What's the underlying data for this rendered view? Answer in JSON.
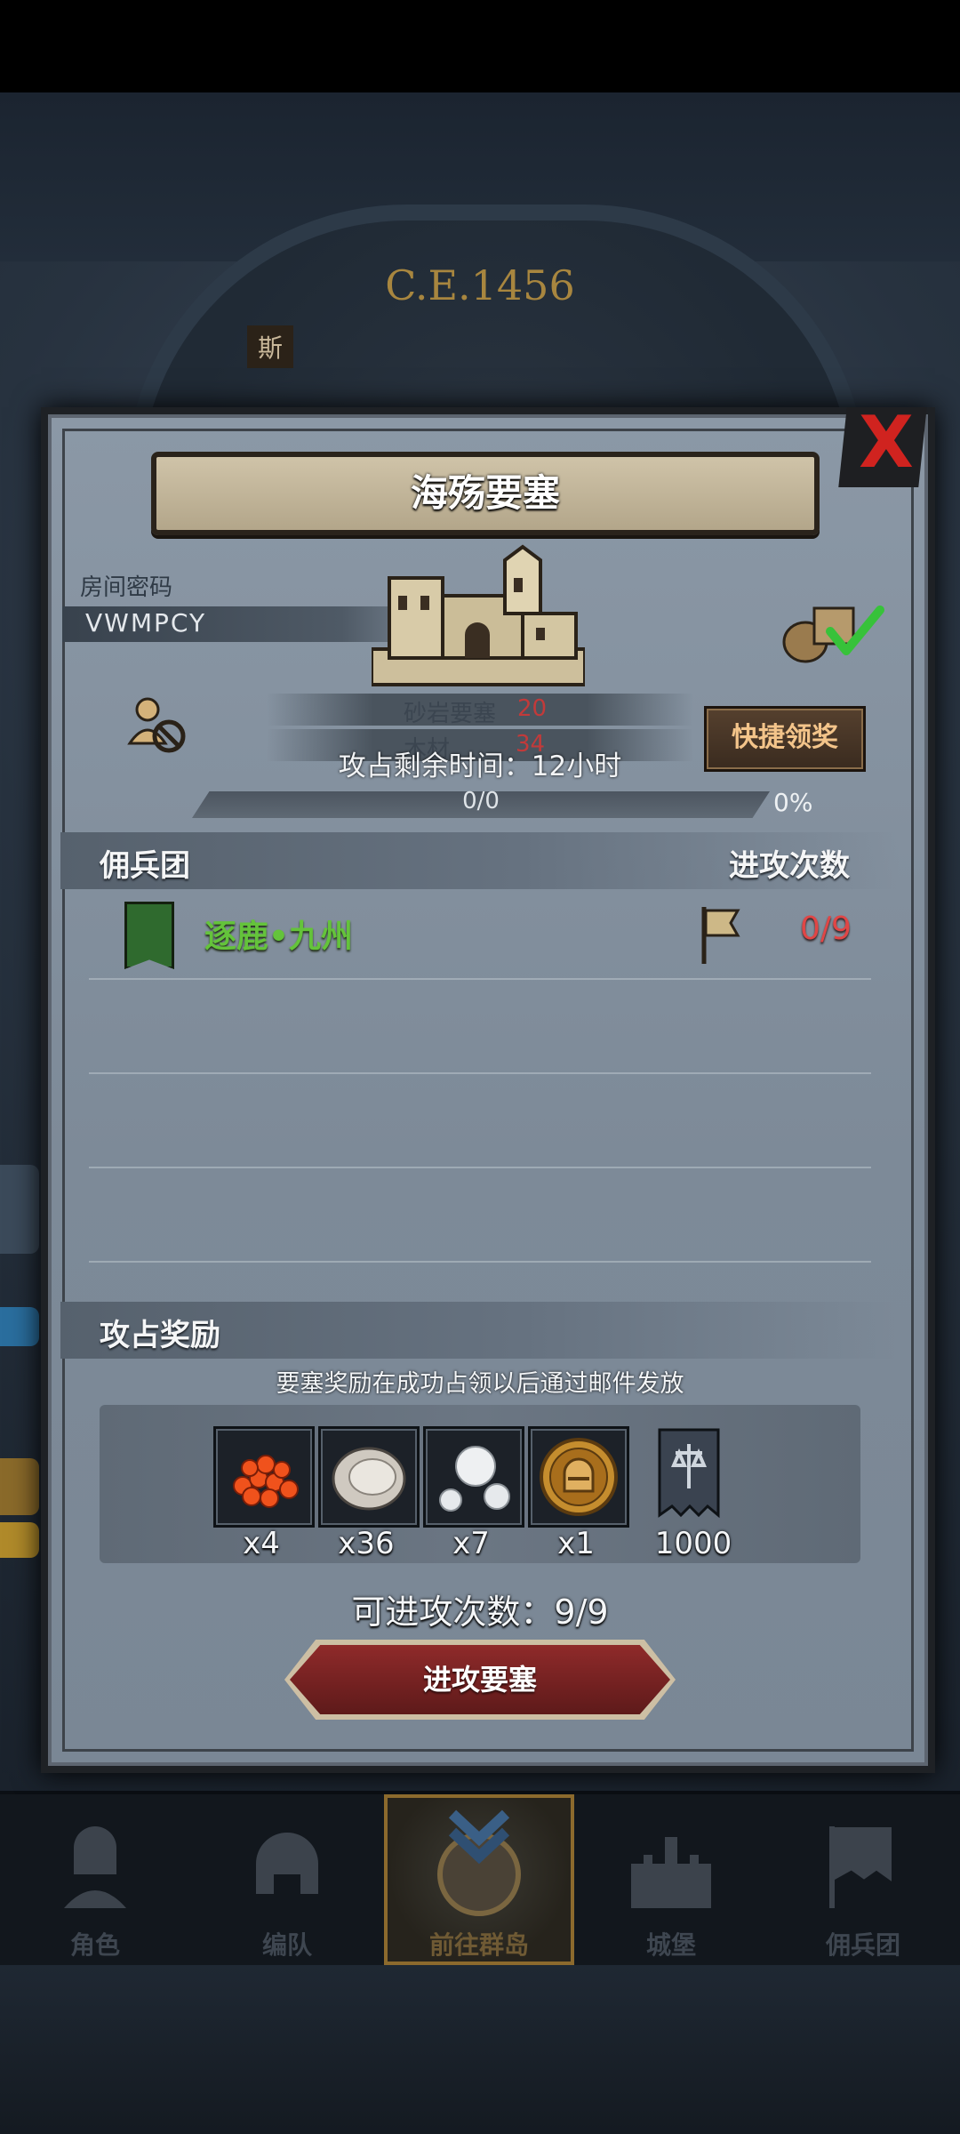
{
  "header": {
    "year": "C.E.1456",
    "location_fragment": "斯"
  },
  "panel": {
    "title": "海殇要塞",
    "close_label": "X",
    "room": {
      "label": "房间密码",
      "code": "VWMPCY"
    },
    "resources": [
      {
        "name": "砂岩要塞",
        "value": "20"
      },
      {
        "name": "木材",
        "value": "34"
      }
    ],
    "quick_claim_label": "快捷领奖",
    "occupation_time_label": "攻占剩余时间：12小时",
    "progress": {
      "text": "0/0",
      "percent_text": "0%",
      "fraction": 0
    },
    "mercenary_section": {
      "title": "佣兵团",
      "attack_count_header": "进攻次数",
      "rows": [
        {
          "name": "逐鹿•九州",
          "count": "0/9"
        }
      ]
    },
    "reward_section": {
      "title": "攻占奖励",
      "note": "要塞奖励在成功占领以后通过邮件发放",
      "items": [
        {
          "icon": "roe-icon",
          "qty": "x4"
        },
        {
          "icon": "oyster-icon",
          "qty": "x36"
        },
        {
          "icon": "pearl-icon",
          "qty": "x7"
        },
        {
          "icon": "knight-medal-icon",
          "qty": "x1"
        },
        {
          "icon": "guild-banner-icon",
          "qty": "1000"
        }
      ]
    },
    "remaining_attacks_label": "可进攻次数：9/9",
    "attack_button_label": "进攻要塞"
  },
  "bottom_nav": {
    "items": [
      {
        "label": "角色",
        "icon": "knight-icon"
      },
      {
        "label": "编队",
        "icon": "helmet-icon"
      },
      {
        "label": "前往群岛",
        "icon": "compass-icon",
        "active": true
      },
      {
        "label": "城堡",
        "icon": "castle-icon"
      },
      {
        "label": "佣兵团",
        "icon": "banner-icon"
      }
    ]
  },
  "colors": {
    "accent_green": "#64c33b",
    "accent_red": "#e04646",
    "button_red": "#8f2a2a",
    "panel_gray": "#8b98a6"
  }
}
